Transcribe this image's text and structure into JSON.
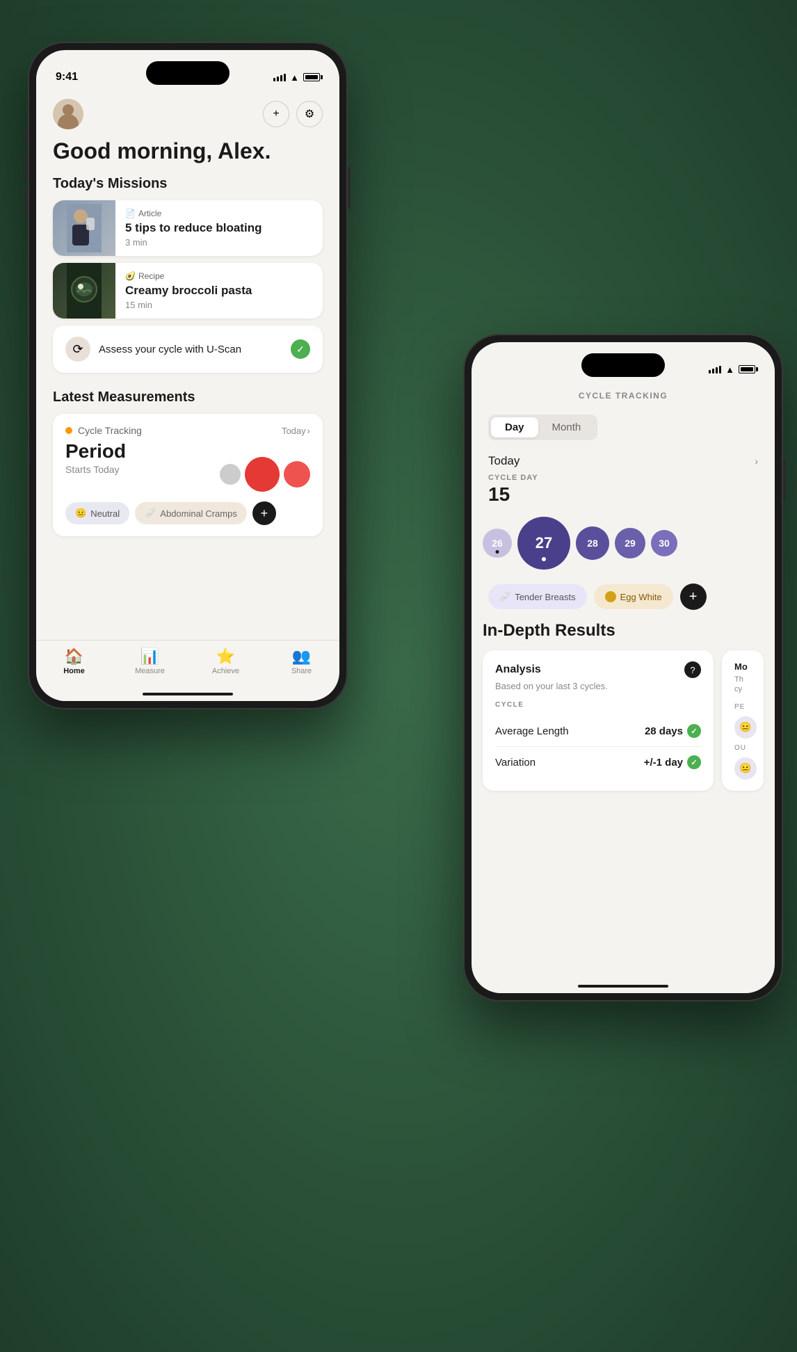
{
  "front_phone": {
    "status": {
      "time": "9:41",
      "signal": [
        2,
        3,
        4,
        5
      ],
      "battery": 80
    },
    "greeting": "Good morning, Alex.",
    "sections": {
      "missions_title": "Today's Missions",
      "missions": [
        {
          "type": "Article",
          "title": "5 tips to reduce bloating",
          "duration": "3 min",
          "type_icon": "📄"
        },
        {
          "type": "Recipe",
          "title": "Creamy broccoli pasta",
          "duration": "15 min",
          "type_icon": "🥑"
        }
      ],
      "uscan": {
        "label": "Assess your cycle with U-Scan"
      },
      "measurements_title": "Latest Measurements",
      "measurement": {
        "type_label": "Cycle Tracking",
        "today_label": "Today",
        "period_title": "Period",
        "period_sub": "Starts Today",
        "tags": [
          {
            "label": "Neutral",
            "icon": "😐",
            "style": "neutral"
          },
          {
            "label": "Abdominal Cramps",
            "icon": "🩹",
            "style": "cramps"
          }
        ]
      }
    },
    "nav": {
      "items": [
        {
          "label": "Home",
          "icon": "🏠",
          "active": true
        },
        {
          "label": "Measure",
          "icon": "📊",
          "active": false
        },
        {
          "label": "Achieve",
          "icon": "⭐",
          "active": false
        },
        {
          "label": "Share",
          "icon": "👥",
          "active": false
        }
      ]
    }
  },
  "back_phone": {
    "status": {
      "signal": [
        2,
        3,
        4,
        5
      ],
      "battery": 80
    },
    "header": "CYCLE TRACKING",
    "toggle": {
      "day_label": "Day",
      "month_label": "Month",
      "active": "Day"
    },
    "today_label": "Today",
    "cycle_day": {
      "label": "CYCLE DAY",
      "value": "15"
    },
    "calendar_days": [
      {
        "num": "26",
        "size": "sm",
        "has_dot": true
      },
      {
        "num": "27",
        "size": "lg",
        "has_dot": true,
        "active": true
      },
      {
        "num": "28",
        "size": "md"
      },
      {
        "num": "29",
        "size": "mdsm"
      },
      {
        "num": "30",
        "size": "xsm"
      }
    ],
    "symptoms": [
      {
        "label": "Tender Breasts",
        "icon": "🩹",
        "style": "purple"
      },
      {
        "label": "Egg White",
        "icon": "🟡",
        "style": "orange"
      }
    ],
    "indepth": {
      "title": "In-Depth Results",
      "analysis": {
        "title": "Analysis",
        "subtitle": "Based on your last 3 cycles.",
        "cycle_label": "CYCLE",
        "rows": [
          {
            "label": "Average Length",
            "value": "28 days",
            "check": true
          },
          {
            "label": "Variation",
            "value": "+/-1 day",
            "check": true
          }
        ]
      }
    }
  }
}
